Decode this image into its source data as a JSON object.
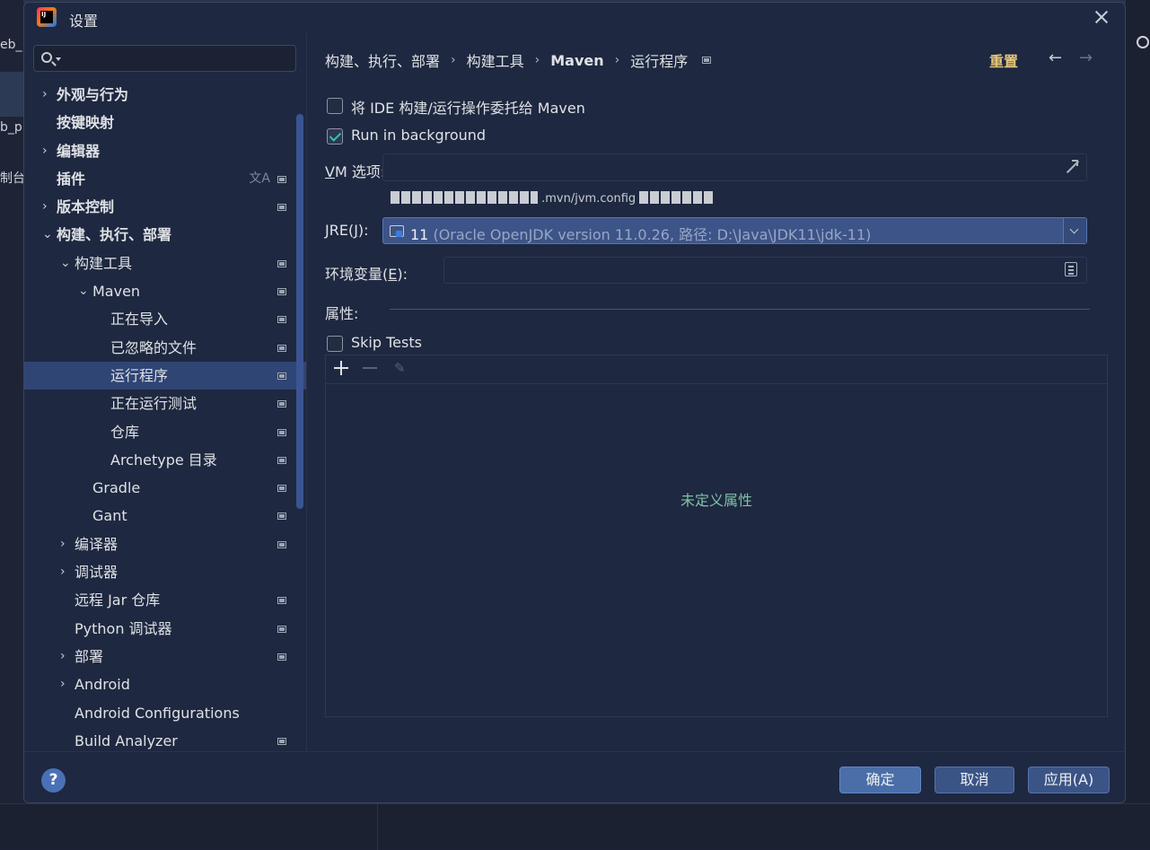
{
  "background": {
    "frag1": "eb_",
    "frag2": "b_p",
    "frag3": "制台"
  },
  "dialog": {
    "title": "设置",
    "app_icon_text": "IJ"
  },
  "search": {
    "placeholder": ""
  },
  "tree": [
    {
      "label": "外观与行为",
      "level": 0,
      "chevron": "›",
      "bold": true
    },
    {
      "label": "按键映射",
      "level": 0,
      "bold": true
    },
    {
      "label": "编辑器",
      "level": 0,
      "chevron": "›",
      "bold": true
    },
    {
      "label": "插件",
      "level": 0,
      "bold": true,
      "translate": "文A"
    },
    {
      "label": "版本控制",
      "level": 0,
      "chevron": "›",
      "bold": true
    },
    {
      "label": "构建、执行、部署",
      "level": 0,
      "chevron": "⌄",
      "bold": true
    },
    {
      "label": "构建工具",
      "level": 1,
      "chevron": "⌄"
    },
    {
      "label": "Maven",
      "level": 2,
      "chevron": "⌄"
    },
    {
      "label": "正在导入",
      "level": 3
    },
    {
      "label": "已忽略的文件",
      "level": 3
    },
    {
      "label": "运行程序",
      "level": 3,
      "selected": true
    },
    {
      "label": "正在运行测试",
      "level": 3
    },
    {
      "label": "仓库",
      "level": 3
    },
    {
      "label": "Archetype 目录",
      "level": 3
    },
    {
      "label": "Gradle",
      "level": 2
    },
    {
      "label": "Gant",
      "level": 2
    },
    {
      "label": "编译器",
      "level": 1,
      "chevron": "›"
    },
    {
      "label": "调试器",
      "level": 1,
      "chevron": "›"
    },
    {
      "label": "远程 Jar 仓库",
      "level": 1
    },
    {
      "label": "Python 调试器",
      "level": 1
    },
    {
      "label": "部署",
      "level": 1,
      "chevron": "›"
    },
    {
      "label": "Android",
      "level": 1,
      "chevron": "›"
    },
    {
      "label": "Android Configurations",
      "level": 1
    },
    {
      "label": "Build Analyzer",
      "level": 1
    }
  ],
  "markers": [
    false,
    false,
    false,
    true,
    true,
    false,
    true,
    true,
    true,
    true,
    true,
    true,
    true,
    true,
    true,
    true,
    true,
    false,
    true,
    true,
    true,
    false,
    false,
    true
  ],
  "breadcrumb": {
    "items": [
      "构建、执行、部署",
      "构建工具",
      "Maven",
      "运行程序"
    ],
    "separator": "›"
  },
  "header": {
    "reset_label": "重置",
    "back": "←",
    "forward": "→"
  },
  "options": {
    "delegate_label": "将 IDE 构建/运行操作委托给 Maven",
    "delegate_checked": false,
    "background_label": "Run in background",
    "background_checked": true,
    "vm_label_key": "V",
    "vm_label_rest": "M 选项:",
    "vm_value": "",
    "hint_text": ".mvn/jvm.config",
    "jre_label_pre": "JRE(",
    "jre_label_key": "J",
    "jre_label_post": "):",
    "jre_version": "11",
    "jre_desc": " (Oracle OpenJDK version 11.0.26, 路径: D:\\Java\\JDK11\\jdk-11)",
    "env_label_pre": "环境变量(",
    "env_label_key": "E",
    "env_label_post": "):",
    "env_value": ""
  },
  "properties": {
    "label": "属性:",
    "skip_tests_label": "Skip Tests",
    "skip_tests_checked": false,
    "empty_text": "未定义属性",
    "add": "+",
    "edit": "✎"
  },
  "footer": {
    "help": "?",
    "ok_label": "确定",
    "cancel_label": "取消",
    "apply_label": "应用(A)"
  },
  "colors": {
    "selection": "#2f4574",
    "accent": "#4a6ea8",
    "reset": "#e6c77b",
    "empty_text": "#7fc2a5"
  }
}
